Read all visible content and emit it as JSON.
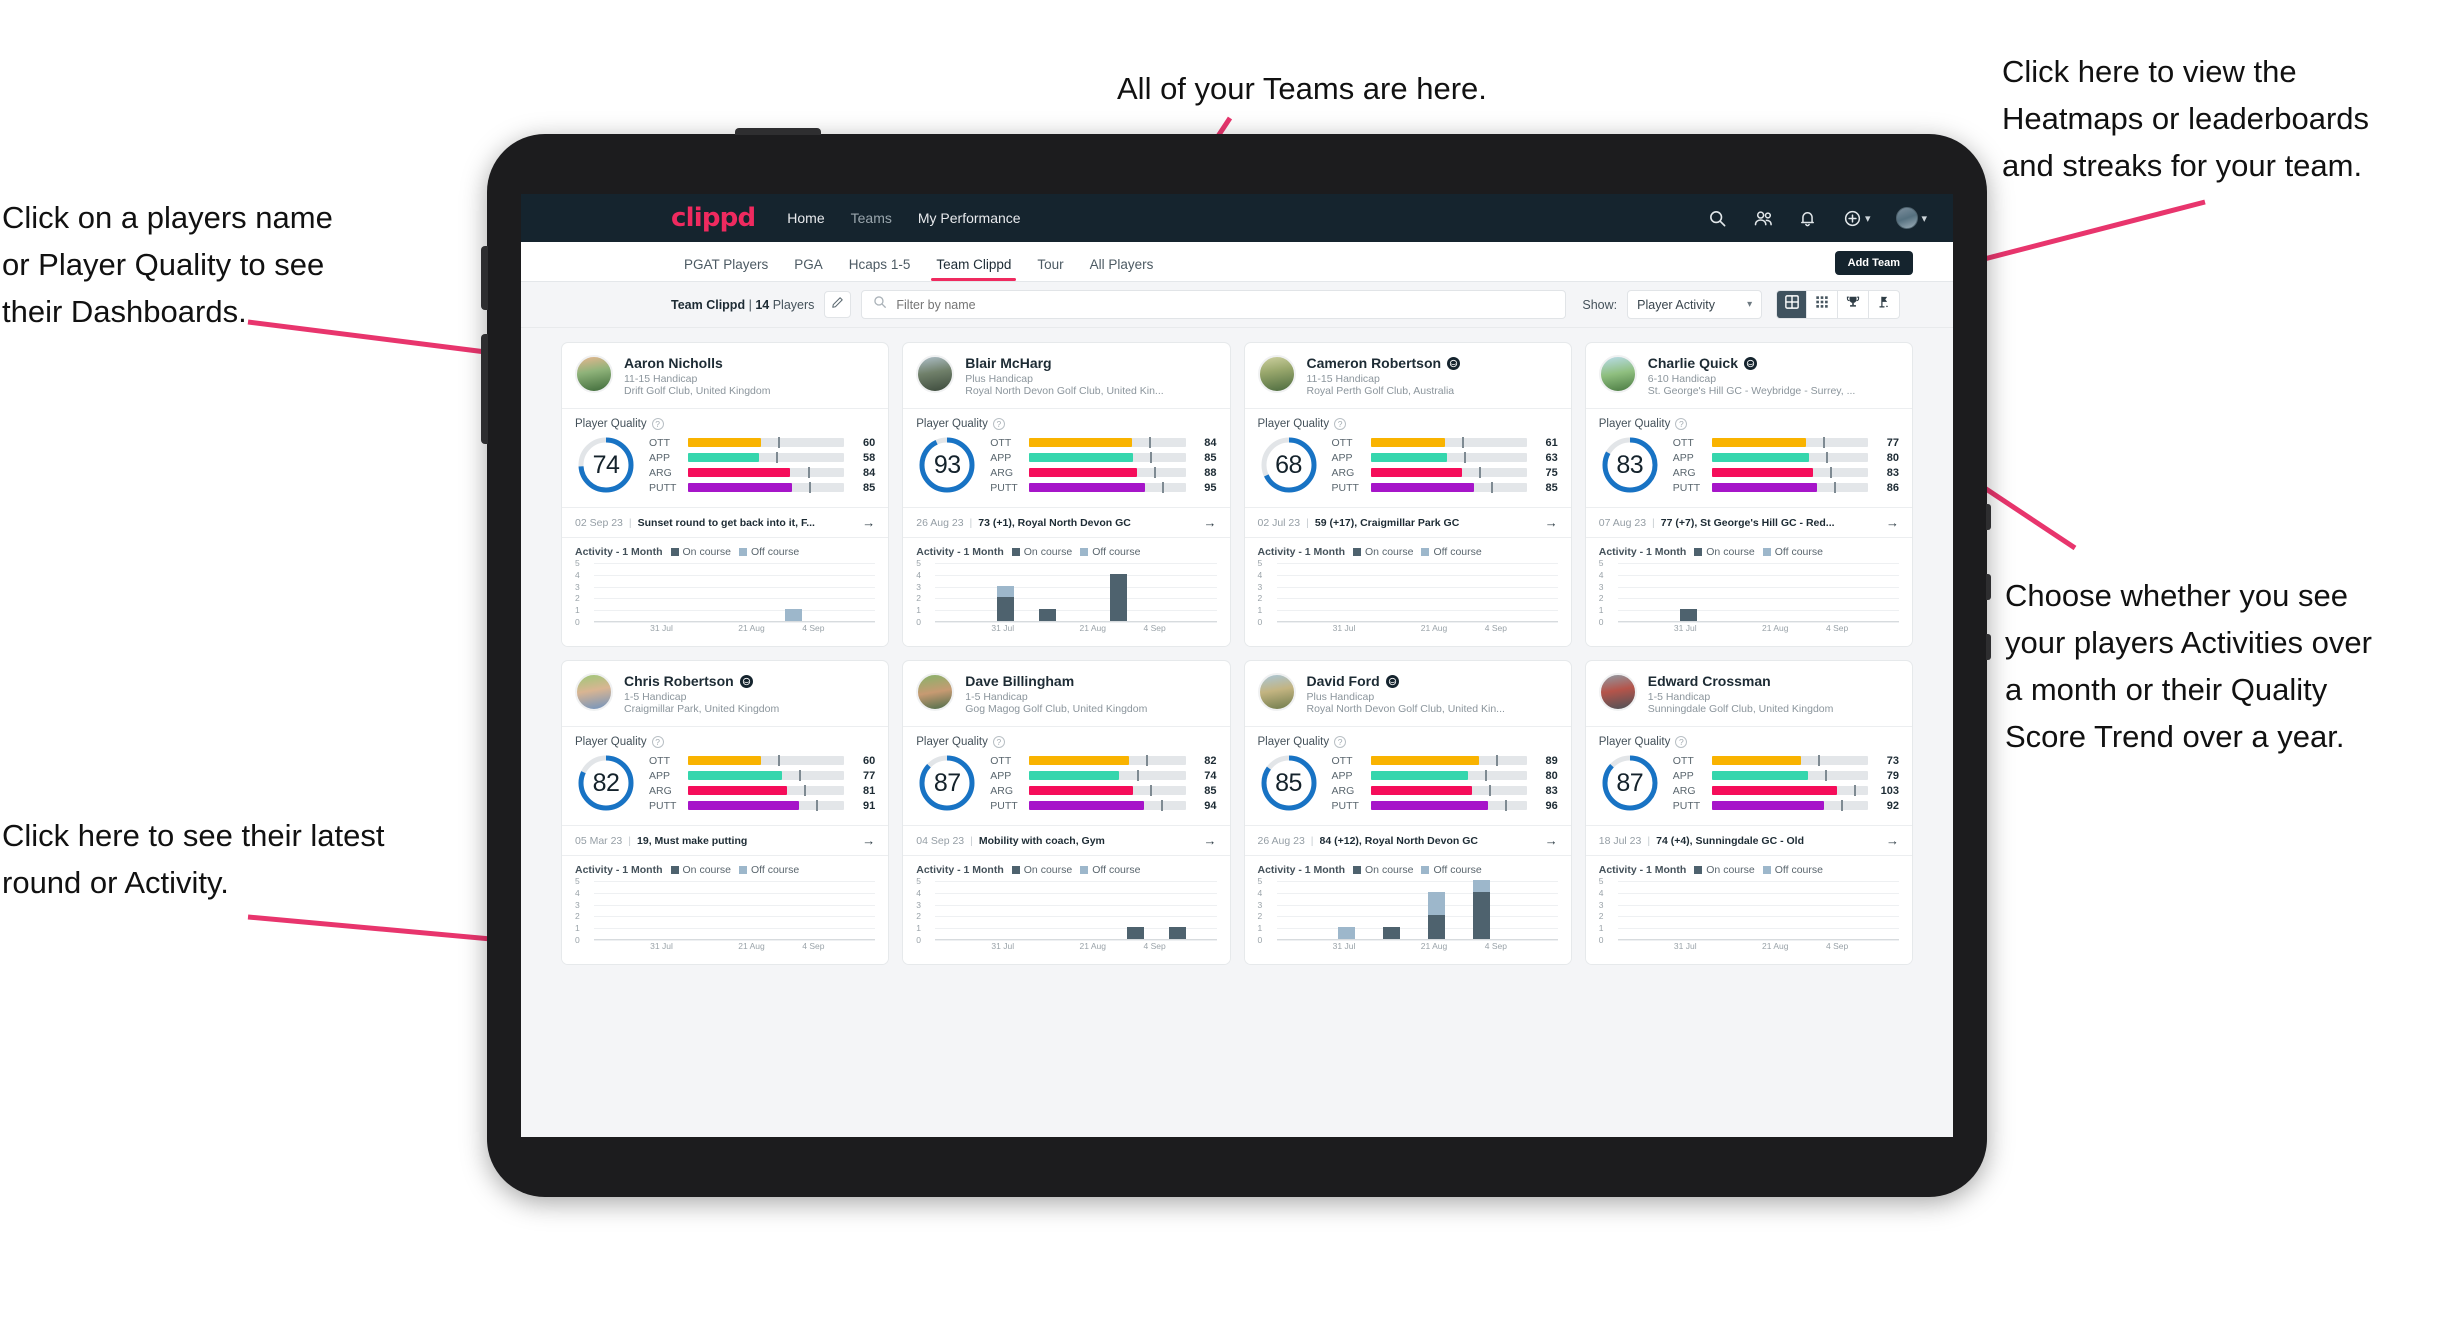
{
  "annotations": [
    {
      "id": "teams-note",
      "text": "All of your Teams are here."
    },
    {
      "id": "heatmaps-note",
      "text": "Click here to view the\nHeatmaps or leaderboards\nand streaks for your team."
    },
    {
      "id": "players-name-note",
      "text": "Click on a players name\nor Player Quality to see\ntheir Dashboards."
    },
    {
      "id": "activity-choice-note",
      "text": "Choose whether you see\nyour players Activities over\na month or their Quality\nScore Trend over a year."
    },
    {
      "id": "latest-round-note",
      "text": "Click here to see their latest\nround or Activity."
    }
  ],
  "topnav": {
    "brand": "clippd",
    "links": [
      {
        "label": "Home",
        "active": true
      },
      {
        "label": "Teams",
        "active": false
      },
      {
        "label": "My Performance",
        "active": true
      }
    ],
    "icons": [
      "search-icon",
      "people-icon",
      "bell-icon",
      "plus-circle-icon",
      "avatar"
    ]
  },
  "subtabs": {
    "items": [
      {
        "label": "PGAT Players",
        "active": false
      },
      {
        "label": "PGA",
        "active": false
      },
      {
        "label": "Hcaps 1-5",
        "active": false
      },
      {
        "label": "Team Clippd",
        "active": true
      },
      {
        "label": "Tour",
        "active": false
      },
      {
        "label": "All Players",
        "active": false
      }
    ],
    "add_team_label": "Add Team"
  },
  "filterbar": {
    "team_name": "Team Clippd",
    "separator": "|",
    "player_count": "14",
    "players_word": "Players",
    "edit_icon": "pencil-icon",
    "search_placeholder": "Filter by name",
    "search_value": "",
    "show_label": "Show:",
    "show_value": "Player Activity",
    "view_buttons": [
      "grid-view-icon",
      "dense-grid-icon",
      "trophy-icon",
      "golf-flag-icon"
    ]
  },
  "chart_data": {
    "type": "bar",
    "title": "Activity - 1 Month",
    "legend": [
      "On course",
      "Off course"
    ],
    "colors": {
      "on_course": "#4e626e",
      "off_course": "#9db7cb"
    },
    "ylim": [
      0,
      5
    ],
    "yticks": [
      0,
      1,
      2,
      3,
      4,
      5
    ],
    "xticks": [
      "31 Jul",
      "21 Aug",
      "4 Sep"
    ]
  },
  "cards": [
    {
      "name": "Aaron Nicholls",
      "verified": false,
      "handicap": "11-15 Handicap",
      "club": "Drift Golf Club, United Kingdom",
      "avatar_css": "linear-gradient(170deg,#e7b68f 0%,#8fb37a 42%,#3f6b3a 100%)",
      "quality_label": "Player Quality",
      "quality_score": 74,
      "bars": [
        {
          "label": "OTT",
          "value": 60,
          "color": "#f9b300"
        },
        {
          "label": "APP",
          "value": 58,
          "color": "#35d6ad"
        },
        {
          "label": "ARG",
          "value": 84,
          "color": "#f50d5a"
        },
        {
          "label": "PUTT",
          "value": 85,
          "color": "#a615c9"
        }
      ],
      "round": {
        "date": "02 Sep 23",
        "text": "Sunset round to get back into it, F..."
      },
      "activity_title": "Activity - 1 Month",
      "activity": [
        {
          "x": 68,
          "on": 0,
          "off": 1
        }
      ]
    },
    {
      "name": "Blair McHarg",
      "verified": false,
      "handicap": "Plus Handicap",
      "club": "Royal North Devon Golf Club, United Kin...",
      "avatar_css": "linear-gradient(170deg,#aebfc8 0%,#70806a 45%,#3c4a3c 100%)",
      "quality_label": "Player Quality",
      "quality_score": 93,
      "bars": [
        {
          "label": "OTT",
          "value": 84,
          "color": "#f9b300"
        },
        {
          "label": "APP",
          "value": 85,
          "color": "#35d6ad"
        },
        {
          "label": "ARG",
          "value": 88,
          "color": "#f50d5a"
        },
        {
          "label": "PUTT",
          "value": 95,
          "color": "#a615c9"
        }
      ],
      "round": {
        "date": "26 Aug 23",
        "text": "73 (+1), Royal North Devon GC"
      },
      "activity_title": "Activity - 1 Month",
      "activity": [
        {
          "x": 22,
          "on": 2,
          "off": 1
        },
        {
          "x": 37,
          "on": 1,
          "off": 0
        },
        {
          "x": 62,
          "on": 4,
          "off": 0
        }
      ]
    },
    {
      "name": "Cameron Robertson",
      "verified": true,
      "handicap": "11-15 Handicap",
      "club": "Royal Perth Golf Club, Australia",
      "avatar_css": "linear-gradient(170deg,#cdd0a0 0%,#9aa86d 40%,#4c6b3f 100%)",
      "quality_label": "Player Quality",
      "quality_score": 68,
      "bars": [
        {
          "label": "OTT",
          "value": 61,
          "color": "#f9b300"
        },
        {
          "label": "APP",
          "value": 63,
          "color": "#35d6ad"
        },
        {
          "label": "ARG",
          "value": 75,
          "color": "#f50d5a"
        },
        {
          "label": "PUTT",
          "value": 85,
          "color": "#a615c9"
        }
      ],
      "round": {
        "date": "02 Jul 23",
        "text": "59 (+17), Craigmillar Park GC"
      },
      "activity_title": "Activity - 1 Month",
      "activity": []
    },
    {
      "name": "Charlie Quick",
      "verified": true,
      "handicap": "6-10 Handicap",
      "club": "St. George's Hill GC - Weybridge - Surrey, ...",
      "avatar_css": "linear-gradient(170deg,#b9dcea 0%,#8fbf7f 48%,#4a7a42 100%)",
      "quality_label": "Player Quality",
      "quality_score": 83,
      "bars": [
        {
          "label": "OTT",
          "value": 77,
          "color": "#f9b300"
        },
        {
          "label": "APP",
          "value": 80,
          "color": "#35d6ad"
        },
        {
          "label": "ARG",
          "value": 83,
          "color": "#f50d5a"
        },
        {
          "label": "PUTT",
          "value": 86,
          "color": "#a615c9"
        }
      ],
      "round": {
        "date": "07 Aug 23",
        "text": "77 (+7), St George's Hill GC - Red..."
      },
      "activity_title": "Activity - 1 Month",
      "activity": [
        {
          "x": 22,
          "on": 1,
          "off": 0
        }
      ]
    },
    {
      "name": "Chris Robertson",
      "verified": true,
      "handicap": "1-5 Handicap",
      "club": "Craigmillar Park, United Kingdom",
      "avatar_css": "linear-gradient(170deg,#9ec878 0%,#d9b592 45%,#6f93bf 100%)",
      "quality_label": "Player Quality",
      "quality_score": 82,
      "bars": [
        {
          "label": "OTT",
          "value": 60,
          "color": "#f9b300"
        },
        {
          "label": "APP",
          "value": 77,
          "color": "#35d6ad"
        },
        {
          "label": "ARG",
          "value": 81,
          "color": "#f50d5a"
        },
        {
          "label": "PUTT",
          "value": 91,
          "color": "#a615c9"
        }
      ],
      "round": {
        "date": "05 Mar 23",
        "text": "19, Must make putting"
      },
      "activity_title": "Activity - 1 Month",
      "activity": []
    },
    {
      "name": "Dave Billingham",
      "verified": false,
      "handicap": "1-5 Handicap",
      "club": "Gog Magog Golf Club, United Kingdom",
      "avatar_css": "linear-gradient(170deg,#87b36a 0%,#c79a72 50%,#4c6d4a 100%)",
      "quality_label": "Player Quality",
      "quality_score": 87,
      "bars": [
        {
          "label": "OTT",
          "value": 82,
          "color": "#f9b300"
        },
        {
          "label": "APP",
          "value": 74,
          "color": "#35d6ad"
        },
        {
          "label": "ARG",
          "value": 85,
          "color": "#f50d5a"
        },
        {
          "label": "PUTT",
          "value": 94,
          "color": "#a615c9"
        }
      ],
      "round": {
        "date": "04 Sep 23",
        "text": "Mobility with coach, Gym"
      },
      "activity_title": "Activity - 1 Month",
      "activity": [
        {
          "x": 68,
          "on": 1,
          "off": 0
        },
        {
          "x": 83,
          "on": 1,
          "off": 0
        }
      ]
    },
    {
      "name": "David Ford",
      "verified": true,
      "handicap": "Plus Handicap",
      "club": "Royal North Devon Golf Club, United Kin...",
      "avatar_css": "linear-gradient(170deg,#a8c6d8 0%,#c3b481 45%,#6f7b4c 100%)",
      "quality_label": "Player Quality",
      "quality_score": 85,
      "bars": [
        {
          "label": "OTT",
          "value": 89,
          "color": "#f9b300"
        },
        {
          "label": "APP",
          "value": 80,
          "color": "#35d6ad"
        },
        {
          "label": "ARG",
          "value": 83,
          "color": "#f50d5a"
        },
        {
          "label": "PUTT",
          "value": 96,
          "color": "#a615c9"
        }
      ],
      "round": {
        "date": "26 Aug 23",
        "text": "84 (+12), Royal North Devon GC"
      },
      "activity_title": "Activity - 1 Month",
      "activity": [
        {
          "x": 22,
          "on": 0,
          "off": 1
        },
        {
          "x": 38,
          "on": 1,
          "off": 0
        },
        {
          "x": 54,
          "on": 2,
          "off": 2
        },
        {
          "x": 70,
          "on": 4,
          "off": 1
        }
      ]
    },
    {
      "name": "Edward Crossman",
      "verified": false,
      "handicap": "1-5 Handicap",
      "club": "Sunningdale Golf Club, United Kingdom",
      "avatar_css": "linear-gradient(170deg,#8e9aa3 0%,#b5544a 45%,#4a5258 100%)",
      "quality_label": "Player Quality",
      "quality_score": 87,
      "bars": [
        {
          "label": "OTT",
          "value": 73,
          "color": "#f9b300"
        },
        {
          "label": "APP",
          "value": 79,
          "color": "#35d6ad"
        },
        {
          "label": "ARG",
          "value": 103,
          "color": "#f50d5a"
        },
        {
          "label": "PUTT",
          "value": 92,
          "color": "#a615c9"
        }
      ],
      "round": {
        "date": "18 Jul 23",
        "text": "74 (+4), Sunningdale GC - Old"
      },
      "activity_title": "Activity - 1 Month",
      "activity": []
    }
  ]
}
